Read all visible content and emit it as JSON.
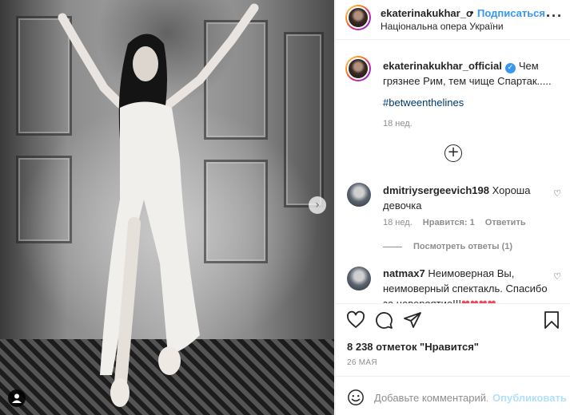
{
  "post": {
    "photo_alt": "",
    "location": "Національна опера України"
  },
  "header": {
    "username": "ekaterinakukhar_o",
    "dot": "•",
    "follow_label": "Подписаться",
    "more_icon": "more-horizontal-icon"
  },
  "caption": {
    "username": "ekaterinakukhar_official",
    "text": "Чем грязнее Рим, тем чище Спартак.....",
    "hashtag": "#betweenthelines",
    "time": "18 нед."
  },
  "load_more_icon": "plus-circle-icon",
  "comments": [
    {
      "username": "dmitriysergeevich198",
      "text": "Хороша девочка",
      "time": "18 нед.",
      "likes": "Нравится: 1",
      "reply": "Ответить",
      "replies_label": "Посмотреть ответы (1)"
    },
    {
      "username": "natmax7",
      "text": "Неимоверная Вы, неимоверный спектакль. Спасибо за невероятие!!!",
      "hearts": "❤❤❤❤"
    }
  ],
  "actions": {
    "like_icon": "heart-icon",
    "comment_icon": "comment-icon",
    "share_icon": "paper-plane-icon",
    "save_icon": "bookmark-icon"
  },
  "likes_text": "8 238 отметок \"Нравится\"",
  "date": "26 МАЯ",
  "add_comment": {
    "placeholder": "Добавьте комментарий...",
    "publish_label": "Опубликовать",
    "emoji_icon": "smiley-icon"
  },
  "colors": {
    "accent": "#3897f0",
    "publish_disabled": "#b2dffc",
    "secondary_text": "#8e8e8e",
    "heart_red": "#ed4956"
  }
}
